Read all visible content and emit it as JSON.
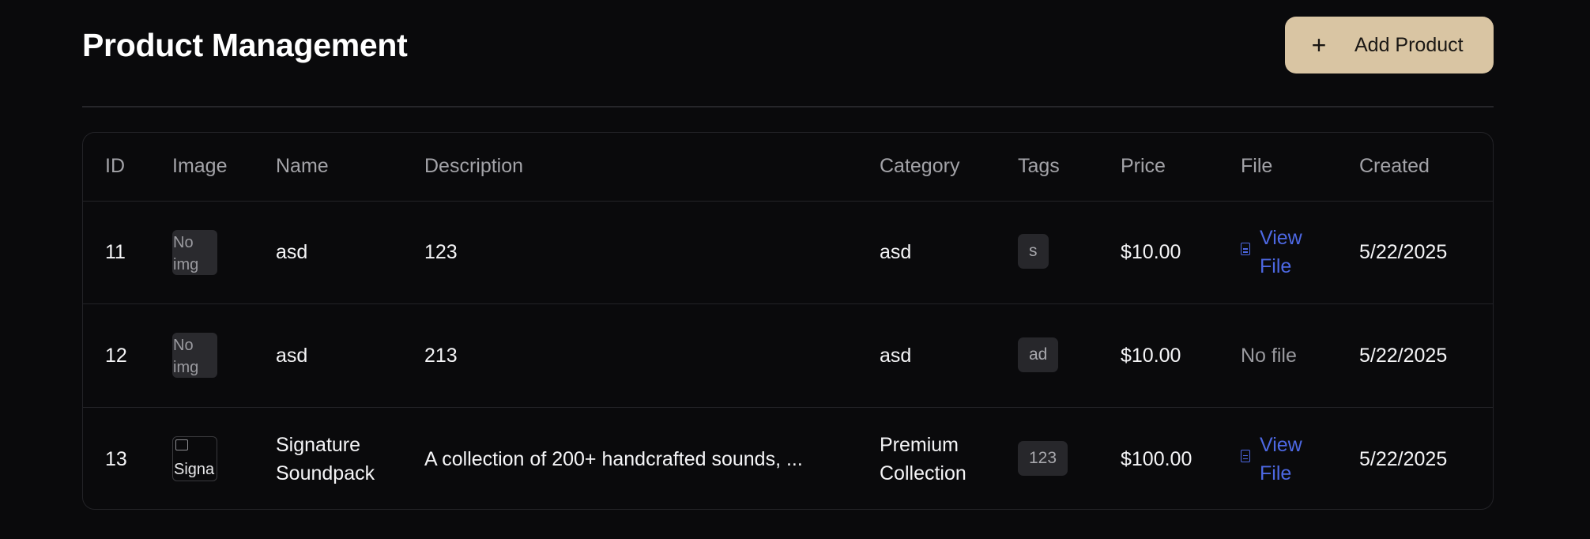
{
  "header": {
    "title": "Product Management",
    "add_button_label": "Add Product",
    "add_button_icon": "plus-icon"
  },
  "table": {
    "columns": [
      "ID",
      "Image",
      "Name",
      "Description",
      "Category",
      "Tags",
      "Price",
      "File",
      "Created"
    ],
    "rows": [
      {
        "id": "11",
        "image": "No img",
        "image_status": "none",
        "name": "asd",
        "description": "123",
        "category": "asd",
        "tag": "s",
        "price": "$10.00",
        "file": "View File",
        "file_status": "link",
        "created": "5/22/2025"
      },
      {
        "id": "12",
        "image": "No img",
        "image_status": "none",
        "name": "asd",
        "description": "213",
        "category": "asd",
        "tag": "ad",
        "price": "$10.00",
        "file": "No file",
        "file_status": "none",
        "created": "5/22/2025"
      },
      {
        "id": "13",
        "image": "Signa",
        "image_status": "broken",
        "name": "Signature Soundpack",
        "description": "A collection of 200+ handcrafted sounds, ...",
        "category": "Premium Collection",
        "tag": "123",
        "price": "$100.00",
        "file": "View File",
        "file_status": "link",
        "created": "5/22/2025"
      }
    ]
  },
  "colors": {
    "background": "#0a0a0c",
    "accent_button": "#d9c5a3",
    "link": "#4d68e3",
    "border": "#232327"
  }
}
